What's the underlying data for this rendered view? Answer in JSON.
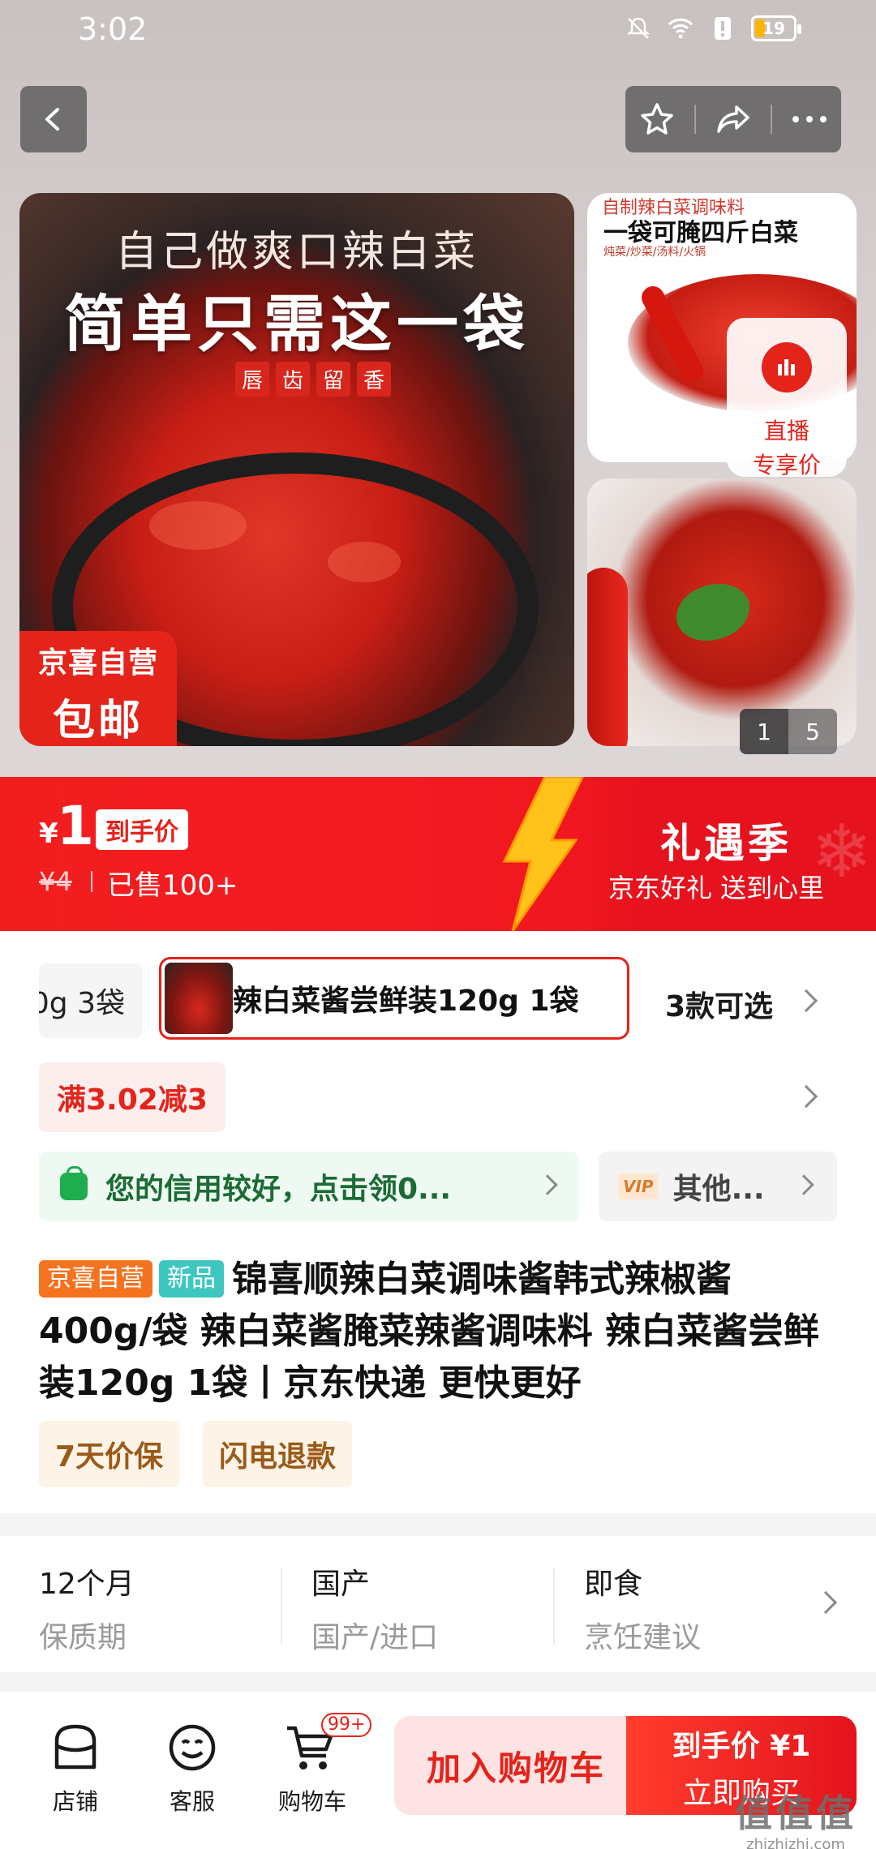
{
  "status_bar": {
    "time": "3:02",
    "battery": "19"
  },
  "gallery": {
    "main_image": {
      "line1": "自己做爽口辣白菜",
      "line2": "简单只需这一袋",
      "stamp": [
        "唇",
        "齿",
        "留",
        "香"
      ],
      "badge_top": "京喜自营",
      "badge_bottom": "包邮"
    },
    "thumb1": {
      "caption_small": "自制辣白菜调味料",
      "caption_big": "一袋可腌四斤白菜",
      "caption_tags": "炖菜/炒菜/汤料/火锅"
    },
    "live_button": {
      "line1": "直播",
      "line2": "专享价"
    },
    "pager": {
      "current": "1",
      "total": "5"
    }
  },
  "price_banner": {
    "currency": "¥",
    "price": "1",
    "price_tag": "到手价",
    "original_price": "¥4",
    "sold": "已售100+",
    "campaign_title": "礼遇季",
    "campaign_sub": "京东好礼 送到心里",
    "colors": {
      "primary": "#e4231a",
      "bolt": "#ffc21a"
    }
  },
  "sku": {
    "prev_label": "0g 3袋",
    "current_label": "辣白菜酱尝鲜装120g 1袋",
    "more_label": "3款可选"
  },
  "promo": {
    "label": "满3.02减3"
  },
  "credit": {
    "label": "您的信用较好，点击领0..."
  },
  "vip": {
    "tag": "VIP",
    "label": "其他..."
  },
  "product": {
    "badge_self": "京喜自营",
    "badge_new": "新品",
    "title": "锦喜顺辣白菜调味酱韩式辣椒酱400g/袋 辣白菜酱腌菜辣酱调味料 辣白菜酱尝鲜装120g 1袋丨京东快递 更快更好"
  },
  "services": [
    "7天价保",
    "闪电退款"
  ],
  "specs": [
    {
      "value": "12个月",
      "key": "保质期"
    },
    {
      "value": "国产",
      "key": "国产/进口"
    },
    {
      "value": "即食",
      "key": "烹饪建议"
    }
  ],
  "bottom_bar": {
    "store": "店铺",
    "service": "客服",
    "cart": "购物车",
    "cart_badge": "99+",
    "add_to_cart": "加入购物车",
    "buy_price": "到手价 ¥1",
    "buy_now": "立即购买"
  },
  "watermark": {
    "text": "值值值",
    "url": "zhizhizhi.com"
  }
}
